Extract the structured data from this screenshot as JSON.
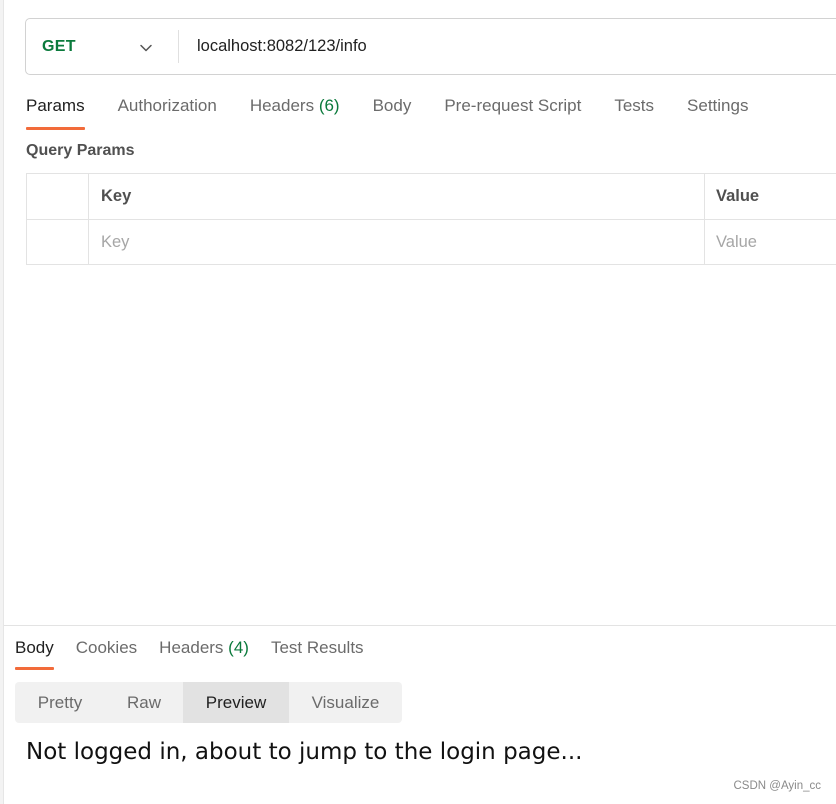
{
  "request": {
    "method": "GET",
    "url": "localhost:8082/123/info"
  },
  "request_tabs": [
    {
      "label": "Params",
      "active": true
    },
    {
      "label": "Authorization"
    },
    {
      "label": "Headers",
      "count": "(6)"
    },
    {
      "label": "Body"
    },
    {
      "label": "Pre-request Script"
    },
    {
      "label": "Tests"
    },
    {
      "label": "Settings"
    }
  ],
  "query_params": {
    "title": "Query Params",
    "columns": {
      "key": "Key",
      "value": "Value"
    },
    "placeholders": {
      "key": "Key",
      "value": "Value"
    }
  },
  "response_tabs": [
    {
      "label": "Body",
      "active": true
    },
    {
      "label": "Cookies"
    },
    {
      "label": "Headers",
      "count": "(4)"
    },
    {
      "label": "Test Results"
    }
  ],
  "view_modes": [
    {
      "label": "Pretty"
    },
    {
      "label": "Raw"
    },
    {
      "label": "Preview",
      "selected": true
    },
    {
      "label": "Visualize"
    }
  ],
  "preview_body": "Not logged in, about to jump to the login page...",
  "watermark": "CSDN @Ayin_cc",
  "colors": {
    "method_get": "#0b7a3c",
    "active_tab_underline": "#f26b3a",
    "count": "#0b7a3c"
  },
  "icons": {
    "method_dropdown": "chevron-down-icon"
  }
}
